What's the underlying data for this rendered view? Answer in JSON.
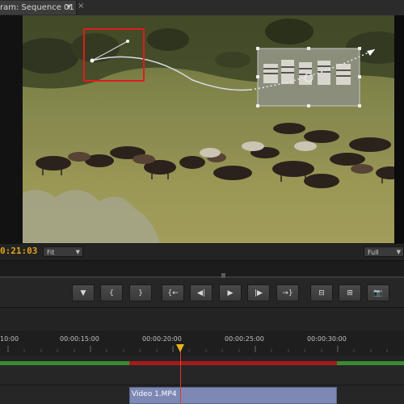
{
  "panel": {
    "tab_title": "ram: Sequence 01",
    "close_glyph": "×",
    "menu_glyph": "▼"
  },
  "monitor": {
    "timecode": "0:21:03",
    "zoom": {
      "value": "Fit",
      "arrow": "▼"
    },
    "resolution": {
      "value": "Full",
      "arrow": "▼"
    }
  },
  "transport": {
    "buttons": [
      {
        "name": "add-marker-button",
        "glyph": "▼"
      },
      {
        "name": "mark-in-button",
        "glyph": "{"
      },
      {
        "name": "mark-out-button",
        "glyph": "}"
      },
      {
        "name": "go-to-in-button",
        "glyph": "{←"
      },
      {
        "name": "step-back-button",
        "glyph": "◀|"
      },
      {
        "name": "play-button",
        "glyph": "▶"
      },
      {
        "name": "step-forward-button",
        "glyph": "|▶"
      },
      {
        "name": "go-to-out-button",
        "glyph": "→}"
      },
      {
        "name": "lift-button",
        "glyph": "⊟"
      },
      {
        "name": "extract-button",
        "glyph": "⊞"
      },
      {
        "name": "export-frame-button",
        "glyph": "📷"
      }
    ]
  },
  "timeline": {
    "timecodes": [
      "10:00",
      "00:00:15:00",
      "00:00:20:00",
      "00:00:25:00",
      "00:00:30:00"
    ],
    "clip_label": "Video 1.MP4"
  },
  "colors": {
    "timecode": "#e1a21d",
    "playhead": "#e03a2f",
    "clip": "#7d88b4",
    "work_area": "#3a8a32",
    "render_red": "#a31c1c",
    "selection_box": "#e01b1b"
  }
}
